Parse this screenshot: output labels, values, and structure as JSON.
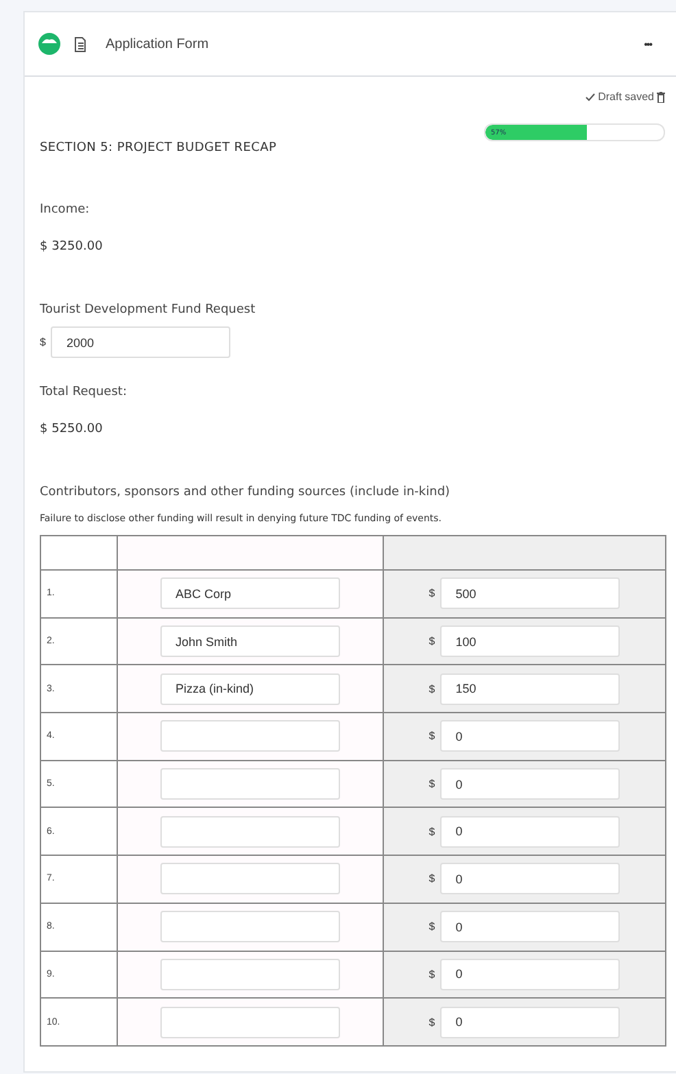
{
  "header": {
    "title": "Application Form",
    "menu": "•••"
  },
  "draft": {
    "status": "Draft saved"
  },
  "progress": {
    "level": 0.57,
    "label": "57%"
  },
  "section_title": "SECTION 5: PROJECT BUDGET RECAP",
  "income": {
    "label": "Income:",
    "value": "$ 3250.00"
  },
  "fund_request": {
    "label": "Tourist Development Fund Request",
    "currency": "$",
    "value": "2000"
  },
  "total_request": {
    "label": "Total Request:",
    "value": "$ 5250.00"
  },
  "contributors": {
    "label": "Contributors, sponsors and other funding sources (include in-kind)",
    "note": "Failure to disclose other funding will result in denying future TDC funding of events.",
    "rows": [
      {
        "number": "1.",
        "name": "ABC Corp",
        "currency": "$",
        "amount": "500"
      },
      {
        "number": "2.",
        "name": "John Smith",
        "currency": "$",
        "amount": "100"
      },
      {
        "number": "3.",
        "name": "Pizza (in-kind)",
        "currency": "$",
        "amount": "150"
      },
      {
        "number": "4.",
        "currency": "$",
        "amount": "0"
      },
      {
        "number": "5.",
        "currency": "$",
        "amount": "0"
      },
      {
        "number": "6.",
        "currency": "$",
        "amount": "0"
      },
      {
        "number": "7.",
        "currency": "$",
        "amount": "0"
      },
      {
        "number": "8.",
        "currency": "$",
        "amount": "0"
      },
      {
        "number": "9.",
        "currency": "$",
        "amount": "0"
      },
      {
        "number": "10.",
        "currency": "$",
        "amount": "0"
      }
    ]
  }
}
